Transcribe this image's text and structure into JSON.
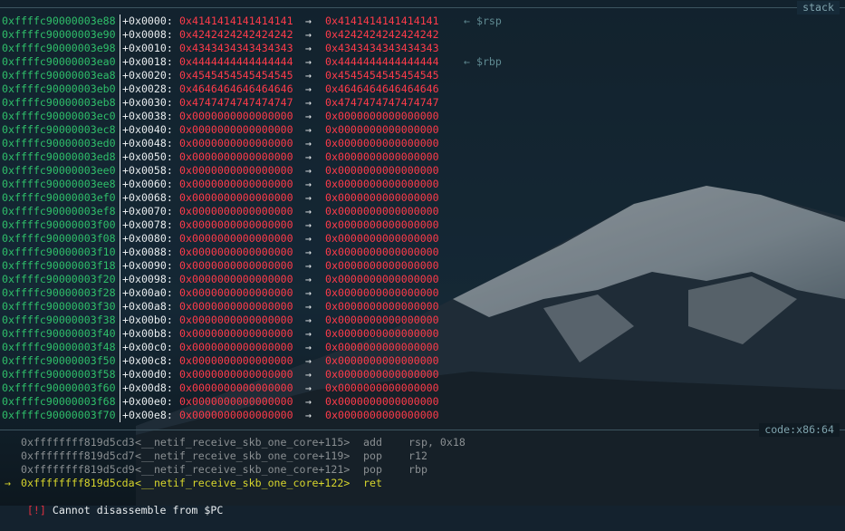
{
  "panes": {
    "stack_title": "stack",
    "code_title": "code:x86:64"
  },
  "stack": [
    {
      "addr": "0xffffc90000003e88",
      "off": "+0x0000:",
      "v1": "0x4141414141414141",
      "arrow": "→",
      "v2": "0x4141414141414141",
      "note": "← $rsp"
    },
    {
      "addr": "0xffffc90000003e90",
      "off": "+0x0008:",
      "v1": "0x4242424242424242",
      "arrow": "→",
      "v2": "0x4242424242424242",
      "note": ""
    },
    {
      "addr": "0xffffc90000003e98",
      "off": "+0x0010:",
      "v1": "0x4343434343434343",
      "arrow": "→",
      "v2": "0x4343434343434343",
      "note": ""
    },
    {
      "addr": "0xffffc90000003ea0",
      "off": "+0x0018:",
      "v1": "0x4444444444444444",
      "arrow": "→",
      "v2": "0x4444444444444444",
      "note": "← $rbp"
    },
    {
      "addr": "0xffffc90000003ea8",
      "off": "+0x0020:",
      "v1": "0x4545454545454545",
      "arrow": "→",
      "v2": "0x4545454545454545",
      "note": ""
    },
    {
      "addr": "0xffffc90000003eb0",
      "off": "+0x0028:",
      "v1": "0x4646464646464646",
      "arrow": "→",
      "v2": "0x4646464646464646",
      "note": ""
    },
    {
      "addr": "0xffffc90000003eb8",
      "off": "+0x0030:",
      "v1": "0x4747474747474747",
      "arrow": "→",
      "v2": "0x4747474747474747",
      "note": ""
    },
    {
      "addr": "0xffffc90000003ec0",
      "off": "+0x0038:",
      "v1": "0x0000000000000000",
      "arrow": "→",
      "v2": "0x0000000000000000",
      "note": ""
    },
    {
      "addr": "0xffffc90000003ec8",
      "off": "+0x0040:",
      "v1": "0x0000000000000000",
      "arrow": "→",
      "v2": "0x0000000000000000",
      "note": ""
    },
    {
      "addr": "0xffffc90000003ed0",
      "off": "+0x0048:",
      "v1": "0x0000000000000000",
      "arrow": "→",
      "v2": "0x0000000000000000",
      "note": ""
    },
    {
      "addr": "0xffffc90000003ed8",
      "off": "+0x0050:",
      "v1": "0x0000000000000000",
      "arrow": "→",
      "v2": "0x0000000000000000",
      "note": ""
    },
    {
      "addr": "0xffffc90000003ee0",
      "off": "+0x0058:",
      "v1": "0x0000000000000000",
      "arrow": "→",
      "v2": "0x0000000000000000",
      "note": ""
    },
    {
      "addr": "0xffffc90000003ee8",
      "off": "+0x0060:",
      "v1": "0x0000000000000000",
      "arrow": "→",
      "v2": "0x0000000000000000",
      "note": ""
    },
    {
      "addr": "0xffffc90000003ef0",
      "off": "+0x0068:",
      "v1": "0x0000000000000000",
      "arrow": "→",
      "v2": "0x0000000000000000",
      "note": ""
    },
    {
      "addr": "0xffffc90000003ef8",
      "off": "+0x0070:",
      "v1": "0x0000000000000000",
      "arrow": "→",
      "v2": "0x0000000000000000",
      "note": ""
    },
    {
      "addr": "0xffffc90000003f00",
      "off": "+0x0078:",
      "v1": "0x0000000000000000",
      "arrow": "→",
      "v2": "0x0000000000000000",
      "note": ""
    },
    {
      "addr": "0xffffc90000003f08",
      "off": "+0x0080:",
      "v1": "0x0000000000000000",
      "arrow": "→",
      "v2": "0x0000000000000000",
      "note": ""
    },
    {
      "addr": "0xffffc90000003f10",
      "off": "+0x0088:",
      "v1": "0x0000000000000000",
      "arrow": "→",
      "v2": "0x0000000000000000",
      "note": ""
    },
    {
      "addr": "0xffffc90000003f18",
      "off": "+0x0090:",
      "v1": "0x0000000000000000",
      "arrow": "→",
      "v2": "0x0000000000000000",
      "note": ""
    },
    {
      "addr": "0xffffc90000003f20",
      "off": "+0x0098:",
      "v1": "0x0000000000000000",
      "arrow": "→",
      "v2": "0x0000000000000000",
      "note": ""
    },
    {
      "addr": "0xffffc90000003f28",
      "off": "+0x00a0:",
      "v1": "0x0000000000000000",
      "arrow": "→",
      "v2": "0x0000000000000000",
      "note": ""
    },
    {
      "addr": "0xffffc90000003f30",
      "off": "+0x00a8:",
      "v1": "0x0000000000000000",
      "arrow": "→",
      "v2": "0x0000000000000000",
      "note": ""
    },
    {
      "addr": "0xffffc90000003f38",
      "off": "+0x00b0:",
      "v1": "0x0000000000000000",
      "arrow": "→",
      "v2": "0x0000000000000000",
      "note": ""
    },
    {
      "addr": "0xffffc90000003f40",
      "off": "+0x00b8:",
      "v1": "0x0000000000000000",
      "arrow": "→",
      "v2": "0x0000000000000000",
      "note": ""
    },
    {
      "addr": "0xffffc90000003f48",
      "off": "+0x00c0:",
      "v1": "0x0000000000000000",
      "arrow": "→",
      "v2": "0x0000000000000000",
      "note": ""
    },
    {
      "addr": "0xffffc90000003f50",
      "off": "+0x00c8:",
      "v1": "0x0000000000000000",
      "arrow": "→",
      "v2": "0x0000000000000000",
      "note": ""
    },
    {
      "addr": "0xffffc90000003f58",
      "off": "+0x00d0:",
      "v1": "0x0000000000000000",
      "arrow": "→",
      "v2": "0x0000000000000000",
      "note": ""
    },
    {
      "addr": "0xffffc90000003f60",
      "off": "+0x00d8:",
      "v1": "0x0000000000000000",
      "arrow": "→",
      "v2": "0x0000000000000000",
      "note": ""
    },
    {
      "addr": "0xffffc90000003f68",
      "off": "+0x00e0:",
      "v1": "0x0000000000000000",
      "arrow": "→",
      "v2": "0x0000000000000000",
      "note": ""
    },
    {
      "addr": "0xffffc90000003f70",
      "off": "+0x00e8:",
      "v1": "0x0000000000000000",
      "arrow": "→",
      "v2": "0x0000000000000000",
      "note": ""
    }
  ],
  "code": [
    {
      "marker": "",
      "addr": "0xffffffff819d5cd3",
      "sym": "<__netif_receive_skb_one_core+115>",
      "mnem": "add",
      "ops": "rsp, 0x18",
      "current": false
    },
    {
      "marker": "",
      "addr": "0xffffffff819d5cd7",
      "sym": "<__netif_receive_skb_one_core+119>",
      "mnem": "pop",
      "ops": "r12",
      "current": false
    },
    {
      "marker": "",
      "addr": "0xffffffff819d5cd9",
      "sym": "<__netif_receive_skb_one_core+121>",
      "mnem": "pop",
      "ops": "rbp",
      "current": false
    },
    {
      "marker": "→",
      "addr": "0xffffffff819d5cda",
      "sym": "<__netif_receive_skb_one_core+122>",
      "mnem": "ret",
      "ops": "",
      "current": true
    }
  ],
  "error": {
    "tag": "[!]",
    "message": "Cannot disassemble from $PC"
  },
  "colors": {
    "address": "#2fbf6a",
    "value": "#ff3b4a",
    "current_line": "#d7d52c",
    "error_tag": "#e0303f"
  }
}
